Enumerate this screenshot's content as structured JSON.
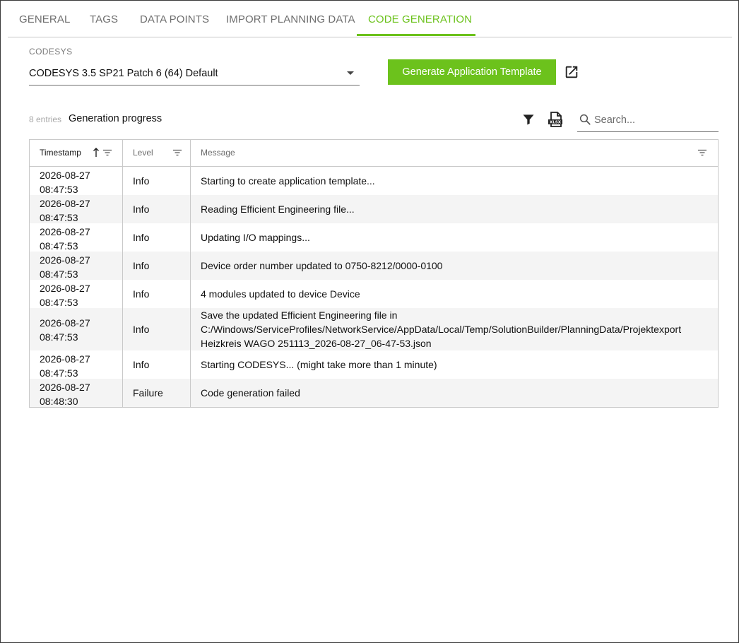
{
  "tabs": [
    {
      "label": "GENERAL"
    },
    {
      "label": "TAGS"
    },
    {
      "label": "DATA POINTS"
    },
    {
      "label": "IMPORT PLANNING DATA"
    },
    {
      "label": "CODE GENERATION"
    }
  ],
  "active_tab": "CODE GENERATION",
  "codesys": {
    "label": "CODESYS",
    "selected": "CODESYS 3.5 SP21 Patch 6 (64) Default"
  },
  "generate_button_label": "Generate Application Template",
  "toolbar": {
    "entries": "8 entries",
    "title": "Generation progress",
    "search_placeholder": "Search..."
  },
  "table": {
    "columns": [
      "Timestamp",
      "Level",
      "Message"
    ],
    "sort": {
      "column": "Timestamp",
      "direction": "ascending"
    },
    "rows": [
      {
        "date": "2026-08-27",
        "time": "08:47:53",
        "level": "Info",
        "message": "Starting to create application template..."
      },
      {
        "date": "2026-08-27",
        "time": "08:47:53",
        "level": "Info",
        "message": "Reading Efficient Engineering file..."
      },
      {
        "date": "2026-08-27",
        "time": "08:47:53",
        "level": "Info",
        "message": "Updating I/O mappings..."
      },
      {
        "date": "2026-08-27",
        "time": "08:47:53",
        "level": "Info",
        "message": "Device order number updated to 0750-8212/0000-0100"
      },
      {
        "date": "2026-08-27",
        "time": "08:47:53",
        "level": "Info",
        "message": "4 modules updated to device Device"
      },
      {
        "date": "2026-08-27",
        "time": "08:47:53",
        "level": "Info",
        "message": "Save the updated Efficient Engineering file in\nC:/Windows/ServiceProfiles/NetworkService/AppData/Local/Temp/SolutionBuilder/PlanningData/Projektexport\nHeizkreis WAGO 251113_2026-08-27_06-47-53.json"
      },
      {
        "date": "2026-08-27",
        "time": "08:47:53",
        "level": "Info",
        "message": "Starting CODESYS... (might take more than 1 minute)"
      },
      {
        "date": "2026-08-27",
        "time": "08:48:30",
        "level": "Failure",
        "message": "Code generation failed"
      }
    ]
  },
  "colors": {
    "accent": "#6cc21c",
    "row_alt": "#f4f4f4",
    "border": "#c9c9c9"
  },
  "icons": [
    "open-in-new-icon",
    "filter-icon",
    "xlsx-export-icon",
    "search-icon",
    "sort-ascending-icon",
    "column-filter-icon",
    "dropdown-caret-icon"
  ]
}
